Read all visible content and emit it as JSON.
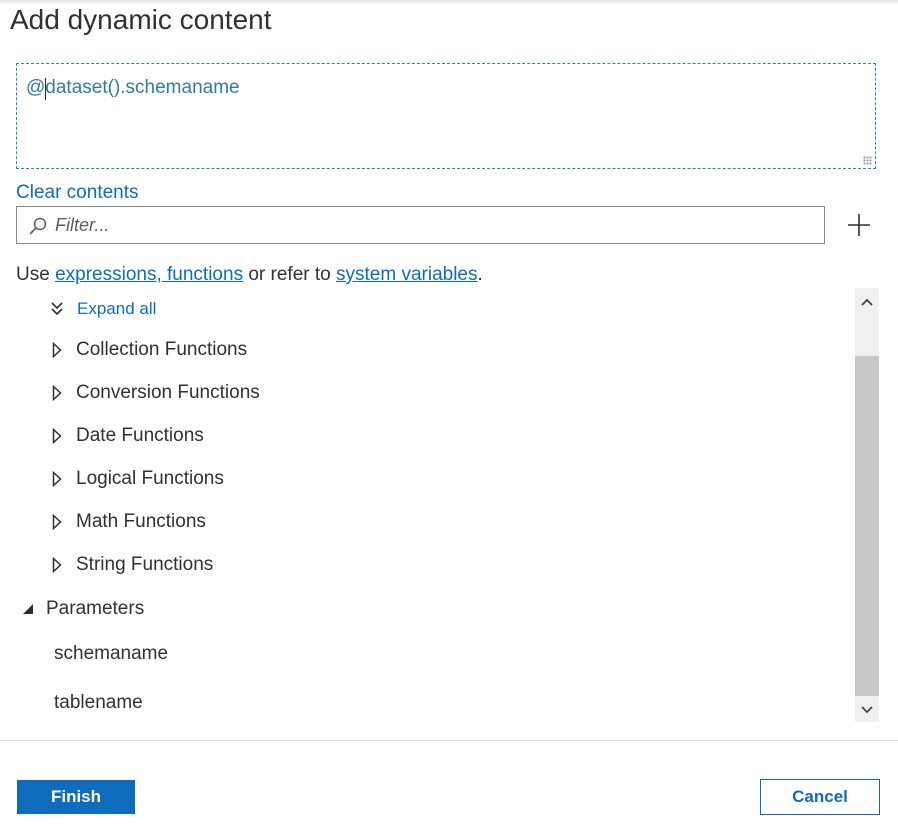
{
  "dialog": {
    "title": "Add dynamic content"
  },
  "expression": {
    "value": "@dataset().schemaname"
  },
  "clear_contents_label": "Clear contents",
  "filter": {
    "placeholder": "Filter...",
    "search_icon": "search-icon",
    "add_icon": "plus-icon"
  },
  "hint": {
    "prefix": "Use ",
    "link1": "expressions, functions",
    "middle": " or refer to ",
    "link2": "system variables",
    "suffix": "."
  },
  "tree": {
    "expand_all_label": "Expand all",
    "categories": [
      {
        "label": "Collection Functions",
        "expanded": false
      },
      {
        "label": "Conversion Functions",
        "expanded": false
      },
      {
        "label": "Date Functions",
        "expanded": false
      },
      {
        "label": "Logical Functions",
        "expanded": false
      },
      {
        "label": "Math Functions",
        "expanded": false
      },
      {
        "label": "String Functions",
        "expanded": false
      }
    ],
    "parameters": {
      "label": "Parameters",
      "expanded": true,
      "items": [
        "schemaname",
        "tablename"
      ]
    }
  },
  "footer": {
    "finish_label": "Finish",
    "cancel_label": "Cancel"
  },
  "colors": {
    "accent": "#0f6cbd",
    "expression_text": "#2f7f96",
    "expression_border": "#1b8bbd"
  }
}
